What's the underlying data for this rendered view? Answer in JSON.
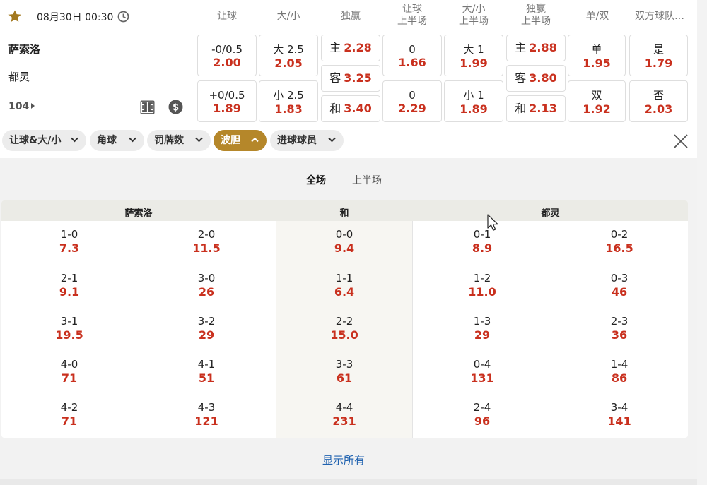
{
  "match": {
    "datetime": "08月30日 00:30",
    "home": "萨索洛",
    "away": "都灵",
    "more_markets": "104"
  },
  "columns": [
    "让球",
    "大/小",
    "独赢",
    "让球\n上半场",
    "大/小\n上半场",
    "独赢\n上半场",
    "单/双",
    "双方球队…"
  ],
  "odds": {
    "handicap": [
      {
        "line": "-0/0.5",
        "odd": "2.00"
      },
      {
        "line": "+0/0.5",
        "odd": "1.89"
      }
    ],
    "total": [
      {
        "line": "大 2.5",
        "odd": "2.05"
      },
      {
        "line": "小 2.5",
        "odd": "1.83"
      }
    ],
    "moneyline": [
      {
        "line": "主",
        "odd": "2.28"
      },
      {
        "line": "客",
        "odd": "3.25"
      },
      {
        "line": "和",
        "odd": "3.40"
      }
    ],
    "handicap_1h": [
      {
        "line": "0",
        "odd": "1.66"
      },
      {
        "line": "0",
        "odd": "2.29"
      }
    ],
    "total_1h": [
      {
        "line": "大 1",
        "odd": "1.99"
      },
      {
        "line": "小 1",
        "odd": "1.89"
      }
    ],
    "moneyline_1h": [
      {
        "line": "主",
        "odd": "2.88"
      },
      {
        "line": "客",
        "odd": "3.80"
      },
      {
        "line": "和",
        "odd": "2.13"
      }
    ],
    "odd_even": [
      {
        "line": "单",
        "odd": "1.95"
      },
      {
        "line": "双",
        "odd": "1.92"
      }
    ],
    "btts": [
      {
        "line": "是",
        "odd": "1.79"
      },
      {
        "line": "否",
        "odd": "2.03"
      }
    ]
  },
  "filters": [
    "让球&大/小",
    "角球",
    "罚牌数",
    "波胆",
    "进球球员"
  ],
  "correct_score": {
    "periods": [
      "全场",
      "上半场"
    ],
    "headers": [
      "萨索洛",
      "和",
      "都灵"
    ],
    "home": [
      [
        "1-0",
        "7.3"
      ],
      [
        "2-0",
        "11.5"
      ],
      [
        "2-1",
        "9.1"
      ],
      [
        "3-0",
        "26"
      ],
      [
        "3-1",
        "19.5"
      ],
      [
        "3-2",
        "29"
      ],
      [
        "4-0",
        "71"
      ],
      [
        "4-1",
        "51"
      ],
      [
        "4-2",
        "71"
      ],
      [
        "4-3",
        "121"
      ]
    ],
    "draw": [
      [
        "0-0",
        "9.4"
      ],
      [
        "1-1",
        "6.4"
      ],
      [
        "2-2",
        "15.0"
      ],
      [
        "3-3",
        "61"
      ],
      [
        "4-4",
        "231"
      ]
    ],
    "away": [
      [
        "0-1",
        "8.9"
      ],
      [
        "0-2",
        "16.5"
      ],
      [
        "1-2",
        "11.0"
      ],
      [
        "0-3",
        "46"
      ],
      [
        "1-3",
        "29"
      ],
      [
        "2-3",
        "36"
      ],
      [
        "0-4",
        "131"
      ],
      [
        "1-4",
        "86"
      ],
      [
        "2-4",
        "96"
      ],
      [
        "3-4",
        "141"
      ]
    ],
    "show_all": "显示所有"
  },
  "colors": {
    "odd": "#c9301e",
    "accent": "#b5872a",
    "link": "#2163b0"
  }
}
